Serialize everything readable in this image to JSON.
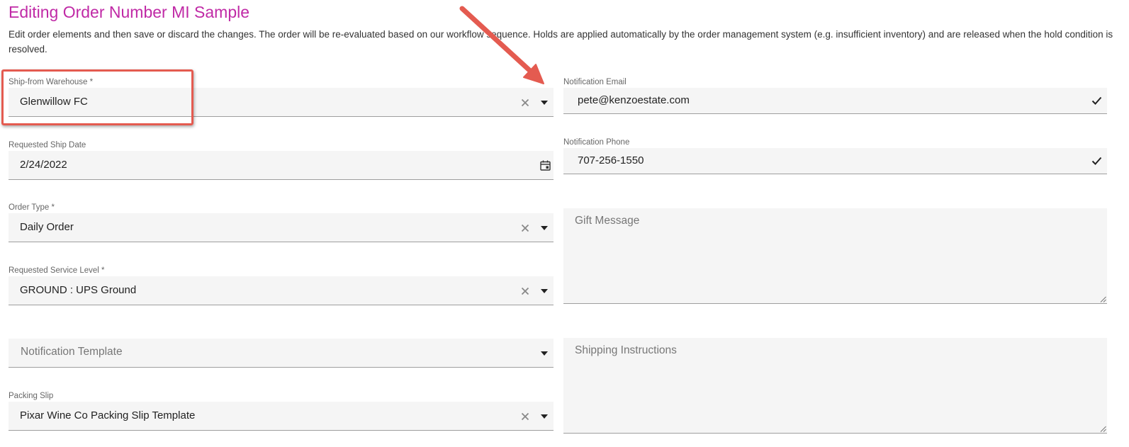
{
  "page": {
    "title": "Editing Order Number MI Sample",
    "intro": "Edit order elements and then save or discard the changes. The order will be re-evaluated based on our workflow sequence. Holds are applied automatically by the order management system (e.g. insufficient inventory) and are released when the hold condition is resolved."
  },
  "left_fields": {
    "warehouse": {
      "label": "Ship-from Warehouse *",
      "value": "Glenwillow FC"
    },
    "ship_date": {
      "label": "Requested Ship Date",
      "value": "2/24/2022"
    },
    "order_type": {
      "label": "Order Type *",
      "value": "Daily Order"
    },
    "service_level": {
      "label": "Requested Service Level *",
      "value": "GROUND : UPS Ground"
    },
    "notification_template": {
      "placeholder": "Notification Template"
    },
    "packing_slip": {
      "label": "Packing Slip",
      "value": "Pixar Wine Co Packing Slip Template"
    }
  },
  "right_fields": {
    "email": {
      "label": "Notification Email",
      "value": "pete@kenzoestate.com"
    },
    "phone": {
      "label": "Notification Phone",
      "value": "707-256-1550"
    },
    "gift_message": {
      "placeholder": "Gift Message"
    },
    "shipping_instructions": {
      "placeholder": "Shipping Instructions"
    }
  },
  "icons": {
    "clear": "close-icon",
    "dropdown": "caret-down-icon",
    "valid": "check-icon",
    "date": "calendar-icon",
    "resize": "resize-handle-icon"
  },
  "colors": {
    "title": "#c02aa6",
    "annotation": "#e45b50",
    "field_background": "#f5f5f5"
  }
}
